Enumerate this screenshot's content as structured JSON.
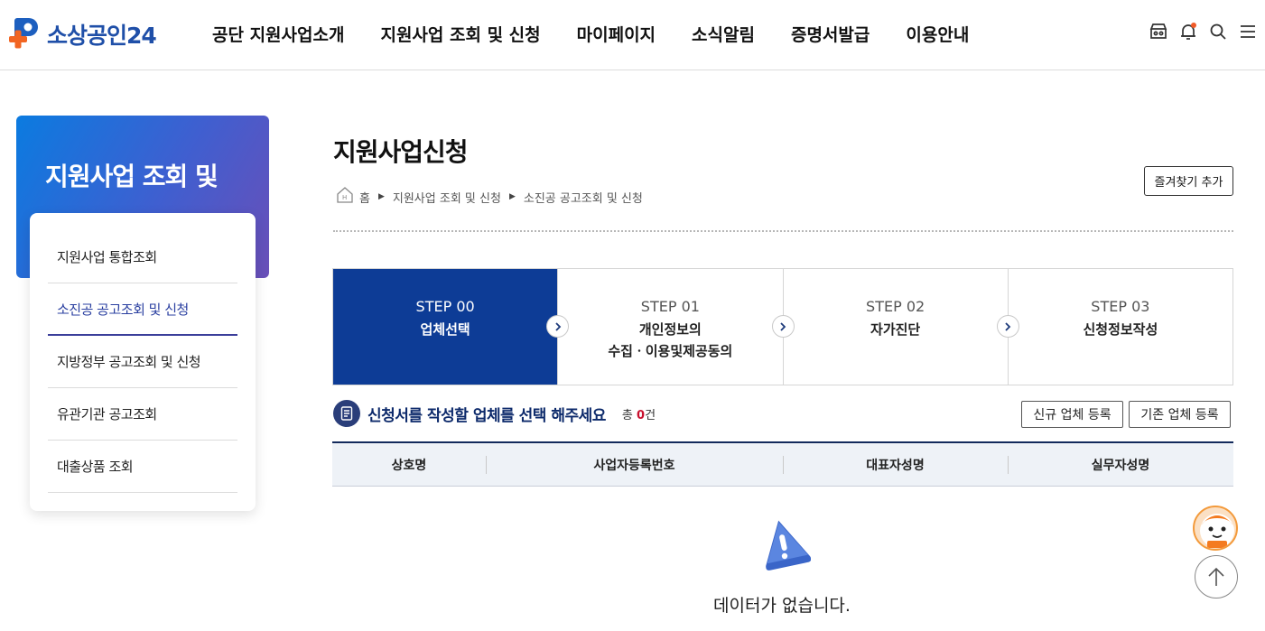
{
  "header": {
    "logo_text": "소상공인24",
    "nav": [
      "공단 지원사업소개",
      "지원사업 조회 및 신청",
      "마이페이지",
      "소식알림",
      "증명서발급",
      "이용안내"
    ],
    "icons": [
      "store-icon",
      "bell-icon",
      "search-icon",
      "menu-icon"
    ],
    "notification_color": "#f05a28"
  },
  "sidebar": {
    "title": "지원사업 조회 및",
    "items": [
      {
        "label": "지원사업 통합조회",
        "active": false
      },
      {
        "label": "소진공 공고조회 및 신청",
        "active": true
      },
      {
        "label": "지방정부 공고조회 및 신청",
        "active": false
      },
      {
        "label": "유관기관 공고조회",
        "active": false
      },
      {
        "label": "대출상품 조회",
        "active": false
      }
    ]
  },
  "main": {
    "title": "지원사업신청",
    "breadcrumb": [
      "홈",
      "지원사업 조회 및 신청",
      "소진공 공고조회 및 신청"
    ],
    "favorite_label": "즐겨찾기 추가",
    "steps": [
      {
        "num": "STEP 00",
        "name": "업체선택",
        "active": true
      },
      {
        "num": "STEP 01",
        "name1": "개인정보의",
        "name2": "수집ㆍ이용및제공동의",
        "active": false
      },
      {
        "num": "STEP 02",
        "name": "자가진단",
        "active": false
      },
      {
        "num": "STEP 03",
        "name": "신청정보작성",
        "active": false
      }
    ],
    "section_title": "신청서를 작성할 업체를 선택 해주세요",
    "count_prefix": "총 ",
    "count": "0",
    "count_suffix": "건",
    "buttons": {
      "new": "신규 업체 등록",
      "existing": "기존 업체 등록"
    },
    "columns": [
      "상호명",
      "사업자등록번호",
      "대표자성명",
      "실무자성명"
    ],
    "empty_message": "데이터가 없습니다.",
    "accent_color": "#0d3c96"
  }
}
